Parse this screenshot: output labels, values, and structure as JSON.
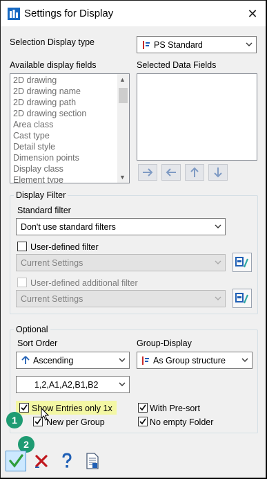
{
  "window": {
    "title": "Settings for Display",
    "close_glyph": "✕"
  },
  "selection_display": {
    "label": "Selection Display type",
    "value": "PS Standard"
  },
  "available_fields": {
    "label": "Available display fields",
    "items": [
      "2D drawing",
      "2D drawing name",
      "2D drawing path",
      "2D drawing section",
      "Area class",
      "Cast type",
      "Detail style",
      "Dimension points",
      "Display class",
      "Element type"
    ]
  },
  "selected_fields": {
    "label": "Selected Data Fields"
  },
  "display_filter": {
    "title": "Display Filter",
    "standard_filter_label": "Standard filter",
    "standard_filter_value": "Don't use standard filters",
    "user_defined_label": "User-defined filter",
    "user_defined_value": "Current Settings",
    "user_defined_additional_label": "User-defined additional filter",
    "user_defined_additional_value": "Current Settings"
  },
  "optional": {
    "title": "Optional",
    "sort_order_label": "Sort Order",
    "sort_order_value": "Ascending",
    "sort_sequence_value": "1,2,A1,A2,B1,B2",
    "group_display_label": "Group-Display",
    "group_display_value": "As Group structure",
    "show_entries_label": "Show Entries only 1x",
    "new_per_group_label": "New per Group",
    "with_presort_label": "With Pre-sort",
    "no_empty_folder_label": "No empty Folder"
  },
  "markers": {
    "one": "1",
    "two": "2"
  },
  "colors": {
    "marker": "#1e9b72",
    "highlight": "#f3f7a4",
    "ok_check": "#2e9e3a",
    "cancel_x": "#c0171d",
    "help": "#1f5fb5"
  },
  "icons": [
    "app-icon",
    "close-icon",
    "chevron-down-icon",
    "ps-standard-icon",
    "scroll-up-icon",
    "scroll-down-icon",
    "move-right-icon",
    "move-left-icon",
    "move-up-icon",
    "move-down-icon",
    "filter-settings-icon",
    "sort-ascending-icon",
    "group-structure-icon",
    "checkmark-icon",
    "ok-icon",
    "cancel-icon",
    "help-icon",
    "document-icon",
    "mouse-cursor-icon"
  ],
  "checkbox_states": {
    "user_defined_filter": false,
    "user_defined_additional_filter": false,
    "show_entries_only_1x": true,
    "new_per_group": true,
    "with_presort": true,
    "no_empty_folder": true
  }
}
